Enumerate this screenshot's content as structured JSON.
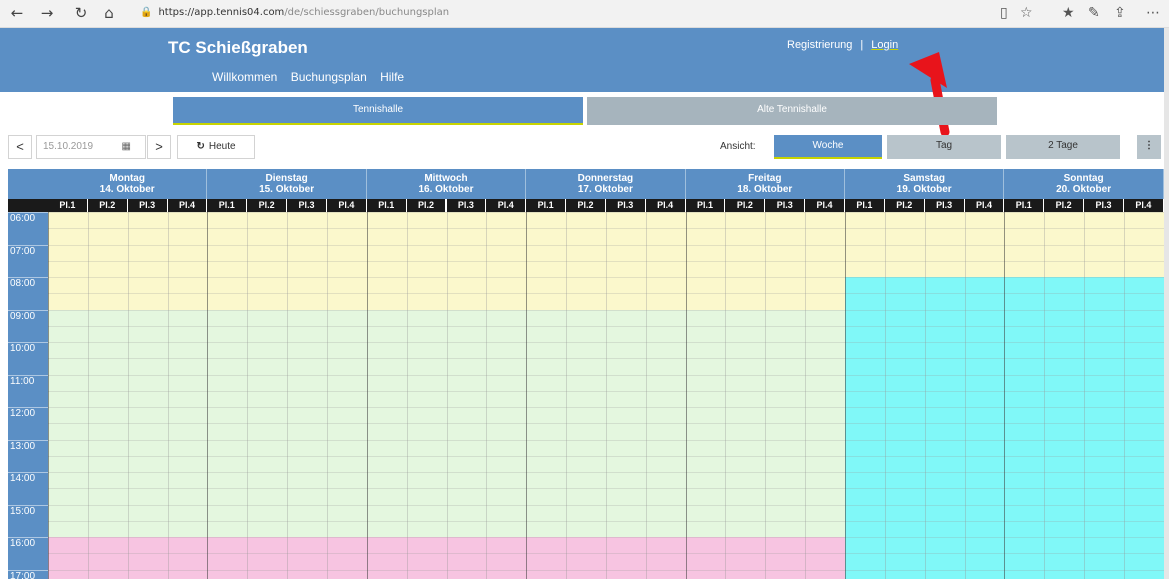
{
  "browser": {
    "back_icon": "←",
    "forward_icon": "→",
    "refresh_icon": "↻",
    "home_icon": "⌂",
    "lock_icon": "🔒",
    "url_host": "https://app.tennis04.com",
    "url_path": "/de/schiessgraben/buchungsplan"
  },
  "header": {
    "title": "TC Schießgraben",
    "nav": [
      "Willkommen",
      "Buchungsplan",
      "Hilfe"
    ],
    "register": "Registrierung",
    "separator": "|",
    "login": "Login"
  },
  "halls": {
    "active": "Tennishalle",
    "inactive": "Alte Tennishalle"
  },
  "toolbar": {
    "prev": "<",
    "date": "15.10.2019",
    "next": ">",
    "today_icon": "↻",
    "today": "Heute",
    "view_label": "Ansicht:",
    "views": [
      "Woche",
      "Tag",
      "2 Tage"
    ],
    "menu": "⋮"
  },
  "calendar": {
    "days": [
      {
        "name": "Montag",
        "date": "14. Oktober"
      },
      {
        "name": "Dienstag",
        "date": "15. Oktober"
      },
      {
        "name": "Mittwoch",
        "date": "16. Oktober"
      },
      {
        "name": "Donnerstag",
        "date": "17. Oktober"
      },
      {
        "name": "Freitag",
        "date": "18. Oktober"
      },
      {
        "name": "Samstag",
        "date": "19. Oktober"
      },
      {
        "name": "Sonntag",
        "date": "20. Oktober"
      }
    ],
    "courts": [
      "Pl.1",
      "Pl.2",
      "Pl.3",
      "Pl.4"
    ],
    "times": [
      "06:00",
      "07:00",
      "08:00",
      "09:00",
      "10:00",
      "11:00",
      "12:00",
      "13:00",
      "14:00",
      "15:00",
      "16:00",
      "17:00"
    ],
    "colors": {
      "yellow": "#fbf8cc",
      "green": "#e4f7df",
      "pink": "#f7c4e1",
      "cyan": "#80f8f8"
    }
  }
}
